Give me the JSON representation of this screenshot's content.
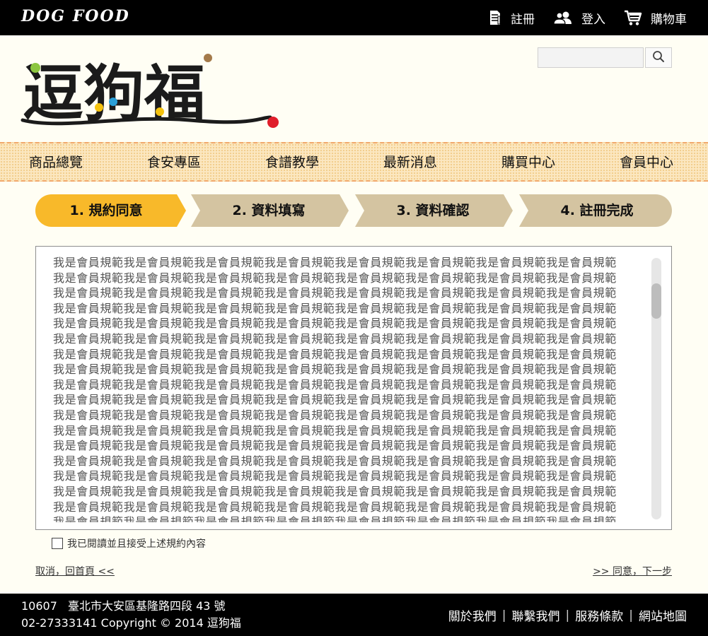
{
  "brand": "DOG  FOOD",
  "top_links": [
    {
      "label": "註冊",
      "icon": "register-icon"
    },
    {
      "label": "登入",
      "icon": "users-icon"
    },
    {
      "label": "購物車",
      "icon": "cart-icon"
    }
  ],
  "logo_text": "逗狗福",
  "search": {
    "placeholder": "",
    "value": ""
  },
  "nav": [
    "商品總覽",
    "食安專區",
    "食譜教學",
    "最新消息",
    "購買中心",
    "會員中心"
  ],
  "steps": [
    {
      "label": "1.  規約同意",
      "active": true
    },
    {
      "label": "2.  資料填寫",
      "active": false
    },
    {
      "label": "3.  資料確認",
      "active": false
    },
    {
      "label": "4.  註冊完成",
      "active": false
    }
  ],
  "terms_text": "我是會員規範我是會員規範我是會員規範我是會員規範我是會員規範我是會員規範我是會員規範我是會員規範我是會員規範我是會員規範我是會員規範我是會員規範我是會員規範我是會員規範我是會員規範我是會員規範我是會員規範我是會員規範我是會員規範我是會員規範我是會員規範我是會員規範我是會員規範我是會員規範我是會員規範我是會員規範我是會員規範我是會員規範我是會員規範我是會員規範我是會員規範我是會員規範我是會員規範我是會員規範我是會員規範我是會員規範我是會員規範我是會員規範我是會員規範我是會員規範我是會員規範我是會員規範我是會員規範我是會員規範我是會員規範我是會員規範我是會員規範我是會員規範我是會員規範我是會員規範我是會員規範我是會員規範我是會員規範我是會員規範我是會員規範我是會員規範我是會員規範我是會員規範我是會員規範我是會員規範我是會員規範我是會員規範我是會員規範我是會員規範我是會員規範我是會員規範我是會員規範我是會員規範我是會員規範我是會員規範我是會員規範我是會員規範我是會員規範我是會員規範我是會員規範我是會員規範我是會員規範我是會員規範我是會員規範我是會員規範我是會員規範我是會員規範我是會員規範我是會員規範我是會員規範我是會員規範我是會員規範我是會員規範我是會員規範我是會員規範我是會員規範我是會員規範我是會員規範我是會員規範我是會員規範我是會員規範我是會員規範我是會員規範我是會員規範我是會員規範我是會員規範我是會員規範我是會員規範我是會員規範我是會員規範我是會員規範我是會員規範我是會員規範我是會員規範我是會員規範我是會員規範我是會員規範我是會員規範我是會員規範我是會員規範我是會員規範我是會員規範我是會員規範我是會員規範我是會員規範我是會員規範我是會員規範我是會員規範我是會員規範我是會員規範我是會員規範我是會員規範我是會員規範我是會員規範我是會員規範我是會員規範我是會員規範我是會員規範我是會員規範我是會員規範我是會員規範我是會員規範我是會員規範我是會員規範我是會員規範我是會員規範我是會員規範我是會員規範我是會員規範我是會員規範我是會員規範我是會員規範我是會員規範我是會員規範我是會員規範我是會員規範我是會員規範我是會員規範我是會員規範我是會員規範我是會員規範我是會員規範我是會員規範我是會員規範我是會員規範我是會員規範我是會員規範我是會",
  "agree_label": "我已閱讀並且接受上述規約內容",
  "agree_checked": false,
  "cancel_link": "取消，回首頁 <<",
  "next_link": ">> 同意，下一步",
  "footer": {
    "postal_code": "10607",
    "address": "臺北市大安區基隆路四段 43 號",
    "phone": "02-27333141",
    "copyright": "Copyright © 2014 逗狗福",
    "links": [
      "關於我們",
      "聯繫我們",
      "服務條款",
      "網站地圖"
    ]
  },
  "colors": {
    "active_step": "#f8b92a",
    "inactive_step": "#d4c4a1",
    "page_bg": "#fffef4",
    "nav_bg": "#fbe7c0",
    "bar_bg": "#000000"
  }
}
